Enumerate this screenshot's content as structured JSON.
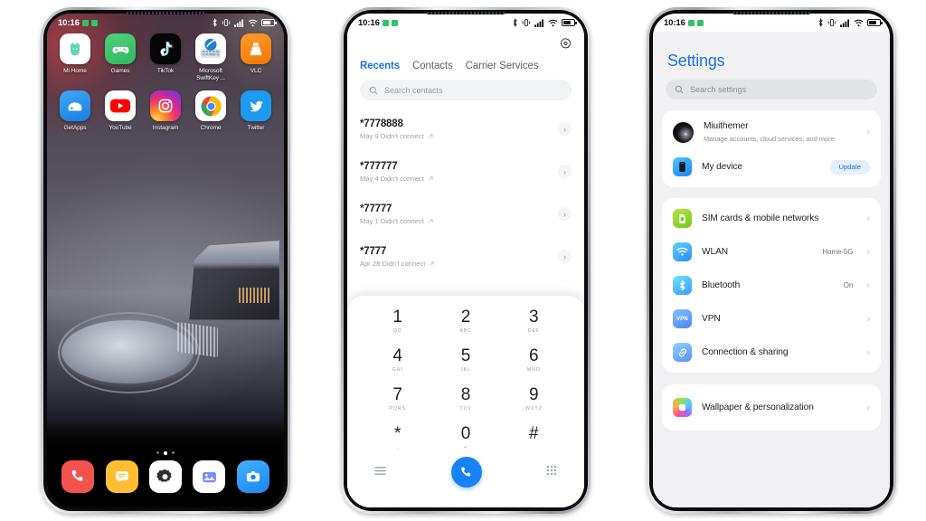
{
  "status_bar": {
    "time": "10:16",
    "icons": [
      "bluetooth-icon",
      "vibrate-icon",
      "signal-icon",
      "wifi-icon",
      "battery-icon"
    ]
  },
  "phone1": {
    "name": "home-screen",
    "apps_row1": [
      {
        "label": "Mi Home",
        "icon": "mi-home-icon"
      },
      {
        "label": "Games",
        "icon": "games-icon"
      },
      {
        "label": "TikTok",
        "icon": "tiktok-icon"
      },
      {
        "label": "Microsoft SwiftKey ...",
        "icon": "swiftkey-icon"
      },
      {
        "label": "VLC",
        "icon": "vlc-icon"
      }
    ],
    "apps_row2": [
      {
        "label": "GetApps",
        "icon": "getapps-icon"
      },
      {
        "label": "YouTube",
        "icon": "youtube-icon"
      },
      {
        "label": "Instagram",
        "icon": "instagram-icon"
      },
      {
        "label": "Chrome",
        "icon": "chrome-icon"
      },
      {
        "label": "Twitter",
        "icon": "twitter-icon"
      }
    ],
    "dock": [
      {
        "label": "Phone",
        "icon": "phone-icon"
      },
      {
        "label": "Messages",
        "icon": "messages-icon"
      },
      {
        "label": "Settings",
        "icon": "gear-icon"
      },
      {
        "label": "Gallery",
        "icon": "gallery-icon"
      },
      {
        "label": "Camera",
        "icon": "camera-icon"
      }
    ],
    "page_indicator": {
      "pages": 3,
      "active": 2
    }
  },
  "phone2": {
    "name": "dialer-app",
    "settings_icon": "gear-icon",
    "tabs": [
      {
        "label": "Recents",
        "active": true
      },
      {
        "label": "Contacts",
        "active": false
      },
      {
        "label": "Carrier Services",
        "active": false
      }
    ],
    "search": {
      "placeholder": "Search contacts",
      "icon": "search-icon"
    },
    "calls": [
      {
        "number": "*7778888",
        "detail": "May 9 Didn't connect",
        "direction": "outgoing"
      },
      {
        "number": "*777777",
        "detail": "May 4 Didn't connect",
        "direction": "outgoing"
      },
      {
        "number": "*77777",
        "detail": "May 1 Didn't connect",
        "direction": "outgoing"
      },
      {
        "number": "*7777",
        "detail": "Apr 28 Didn't connect",
        "direction": "outgoing"
      }
    ],
    "keypad": [
      {
        "digit": "1",
        "letters": "QD"
      },
      {
        "digit": "2",
        "letters": "ABC"
      },
      {
        "digit": "3",
        "letters": "DEF"
      },
      {
        "digit": "4",
        "letters": "GHI"
      },
      {
        "digit": "5",
        "letters": "JKL"
      },
      {
        "digit": "6",
        "letters": "MNO"
      },
      {
        "digit": "7",
        "letters": "PQRS"
      },
      {
        "digit": "8",
        "letters": "TUV"
      },
      {
        "digit": "9",
        "letters": "WXYZ"
      },
      {
        "digit": "*",
        "letters": ","
      },
      {
        "digit": "0",
        "letters": "+"
      },
      {
        "digit": "#",
        "letters": ""
      }
    ],
    "bottom_bar": {
      "menu_icon": "hamburger-icon",
      "call_icon": "call-icon",
      "keypad_icon": "dialpad-icon",
      "call_button_color": "#1a82f7"
    }
  },
  "phone3": {
    "name": "settings-app",
    "title": "Settings",
    "title_color": "#1a73e8",
    "search": {
      "placeholder": "Search settings",
      "icon": "search-icon"
    },
    "account_card": [
      {
        "title": "Miuithemer",
        "subtitle": "Manage accounts, cloud services, and more",
        "icon": "avatar",
        "badge": "",
        "value": ""
      },
      {
        "title": "My device",
        "subtitle": "",
        "icon": "device-icon",
        "badge": "Update",
        "value": ""
      }
    ],
    "connectivity_card": [
      {
        "title": "SIM cards & mobile networks",
        "icon": "sim-icon",
        "value": ""
      },
      {
        "title": "WLAN",
        "icon": "wifi-icon",
        "value": "Home-5G"
      },
      {
        "title": "Bluetooth",
        "icon": "bluetooth-icon",
        "value": "On"
      },
      {
        "title": "VPN",
        "icon": "vpn-icon",
        "value": ""
      },
      {
        "title": "Connection & sharing",
        "icon": "link-icon",
        "value": ""
      }
    ],
    "personalization_card": [
      {
        "title": "Wallpaper & personalization",
        "icon": "wallpaper-icon",
        "value": ""
      }
    ]
  }
}
